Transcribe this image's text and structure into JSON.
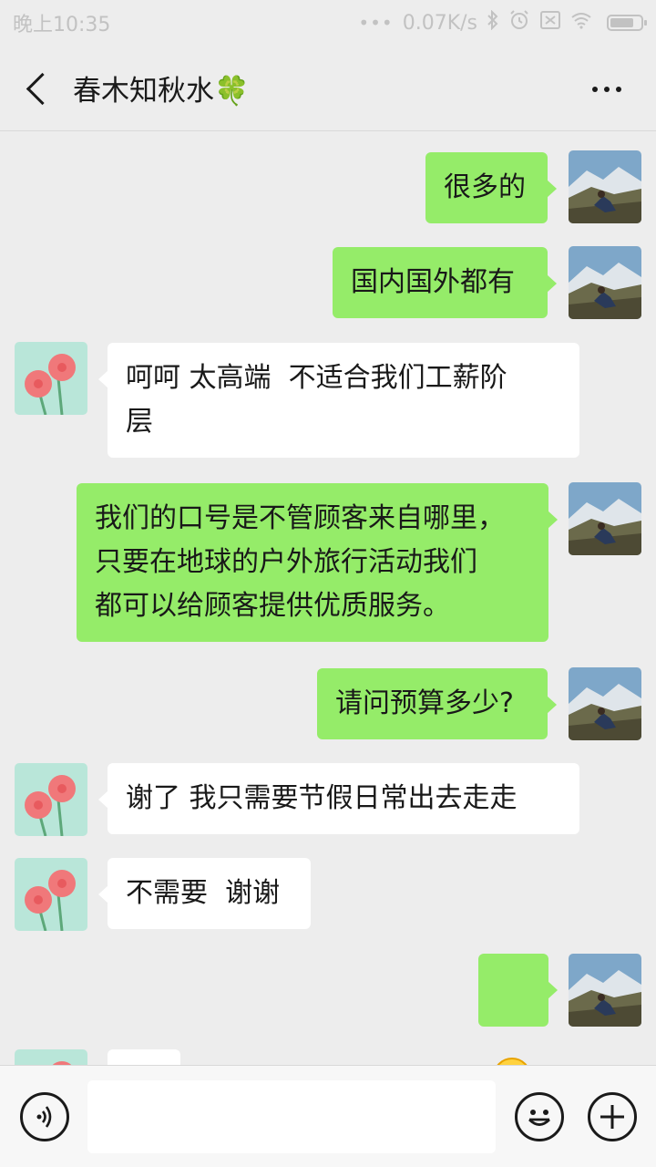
{
  "status_bar": {
    "time": "晚上10:35",
    "dots": "•••",
    "network_speed": "0.07K/s"
  },
  "header": {
    "title": "春木知秋水🍀",
    "back_icon": "chevron-left-icon",
    "more_icon": "more-dots-icon"
  },
  "messages": [
    {
      "sender": "me",
      "text": "很多的"
    },
    {
      "sender": "me",
      "text": "国内国外都有"
    },
    {
      "sender": "them",
      "text": "呵呵 太高端  不适合我们工薪阶\n层"
    },
    {
      "sender": "me",
      "text": "我们的口号是不管顾客来自哪里，\n只要在地球的户外旅行活动我们\n都可以给顾客提供优质服务。"
    },
    {
      "sender": "me",
      "text": "请问预算多少?"
    },
    {
      "sender": "them",
      "text": "谢了 我只需要节假日常出去走走"
    },
    {
      "sender": "them",
      "text": "不需要  谢谢"
    },
    {
      "sender": "me",
      "emoji": "grinning-face-emoji"
    },
    {
      "sender": "them",
      "text": ""
    }
  ],
  "input_bar": {
    "voice_icon": "voice-icon",
    "input_value": "",
    "emoji_icon": "smiley-icon",
    "plus_icon": "plus-icon"
  },
  "colors": {
    "my_bubble": "#95ec69",
    "their_bubble": "#ffffff",
    "background": "#ededed"
  }
}
